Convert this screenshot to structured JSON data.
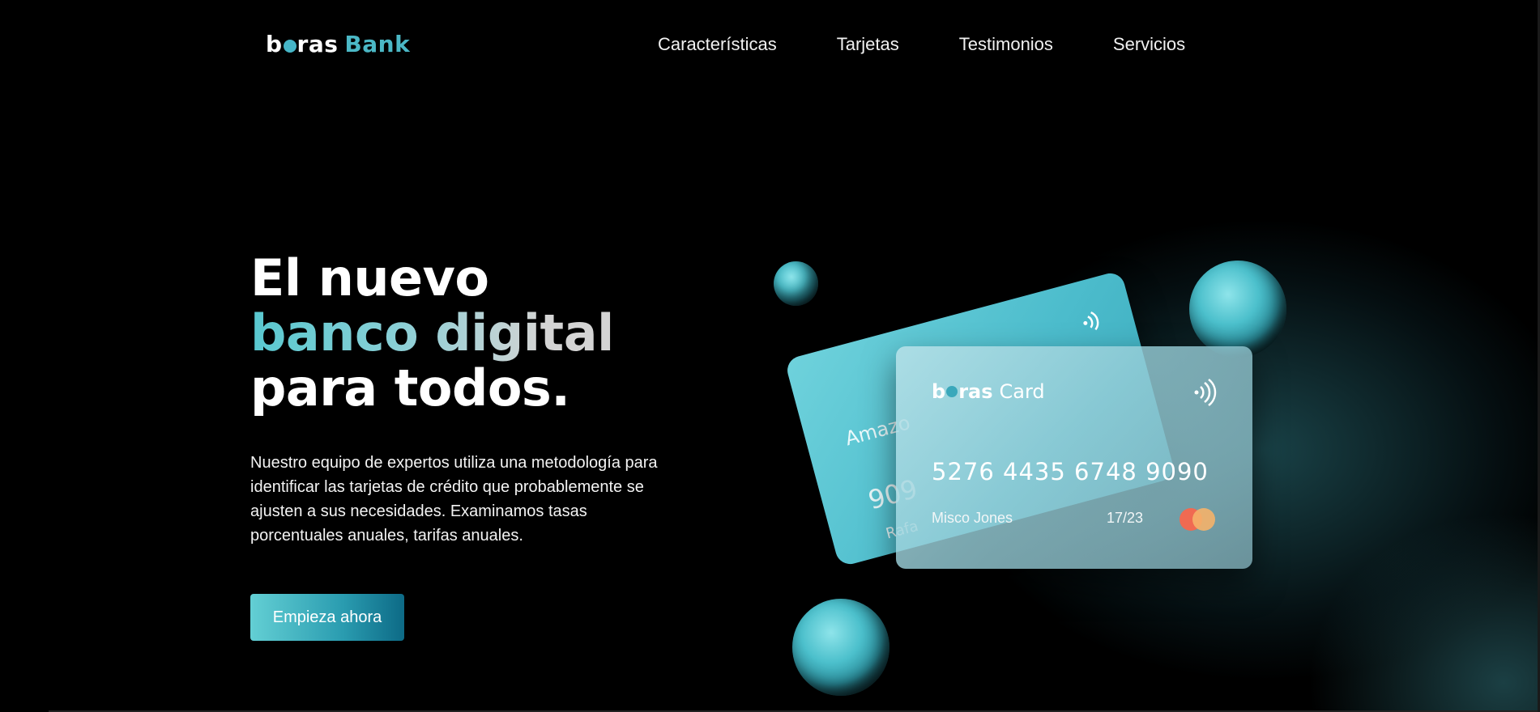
{
  "brand": {
    "name_part1": "b",
    "name_part2": "ras",
    "name_part3": "Bank"
  },
  "nav": {
    "items": [
      {
        "label": "Características"
      },
      {
        "label": "Tarjetas"
      },
      {
        "label": "Testimonios"
      },
      {
        "label": "Servicios"
      }
    ]
  },
  "hero": {
    "title_line1": "El nuevo",
    "title_line2": "banco digital",
    "title_line3": "para todos.",
    "description": "Nuestro equipo de expertos utiliza una metodología para identificar las tarjetas de crédito que probablemente se ajusten a sus necesidades. Examinamos tasas porcentuales anuales, tarifas anuales.",
    "cta_label": "Empieza ahora"
  },
  "card_back": {
    "issuer_text": "Amazo",
    "number_fragment": "909",
    "name_fragment": "Rafa"
  },
  "card_front": {
    "logo_part1": "b",
    "logo_part2": "ras",
    "logo_word": "Card",
    "number": "5276 4435 6748 9090",
    "holder": "Misco Jones",
    "expiry": "17/23"
  },
  "colors": {
    "accent": "#4bb8c6",
    "background": "#000000"
  }
}
